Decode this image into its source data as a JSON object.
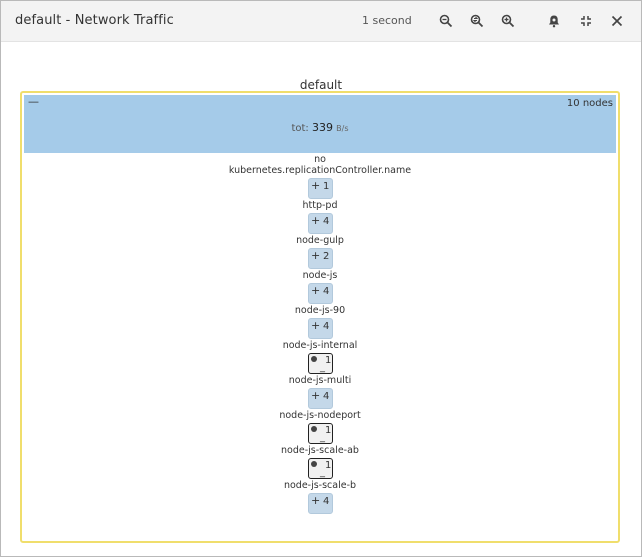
{
  "window": {
    "title": "default - Network Traffic",
    "interval": "1 second",
    "toolbar_icons": [
      "zoom-out-icon",
      "zoom-reset-icon",
      "zoom-in-icon",
      "alert-icon",
      "collapse-icon",
      "close-icon"
    ]
  },
  "group": {
    "title": "default",
    "collapse_symbol": "—",
    "node_count": "10 nodes",
    "tot_prefix": "tot: ",
    "tot_value": "339",
    "tot_unit": "B/s",
    "border_color": "#f0de6c",
    "header_color": "#a5cbe9"
  },
  "items": [
    {
      "label": "no kubernetes.replicationController.name",
      "label_line1": "no",
      "label_line2": "kubernetes.replicationController.name",
      "count": "1",
      "status": "ok"
    },
    {
      "label": "http-pd",
      "count": "4",
      "status": "ok"
    },
    {
      "label": "node-gulp",
      "count": "2",
      "status": "ok"
    },
    {
      "label": "node-js",
      "count": "4",
      "status": "ok"
    },
    {
      "label": "node-js-90",
      "count": "4",
      "status": "ok"
    },
    {
      "label": "node-js-internal",
      "count": "1",
      "status": "warn"
    },
    {
      "label": "node-js-multi",
      "count": "4",
      "status": "ok"
    },
    {
      "label": "node-js-nodeport",
      "count": "1",
      "status": "warn"
    },
    {
      "label": "node-js-scale-ab",
      "count": "1",
      "status": "warn"
    },
    {
      "label": "node-js-scale-b",
      "count": "4",
      "status": "ok"
    }
  ]
}
